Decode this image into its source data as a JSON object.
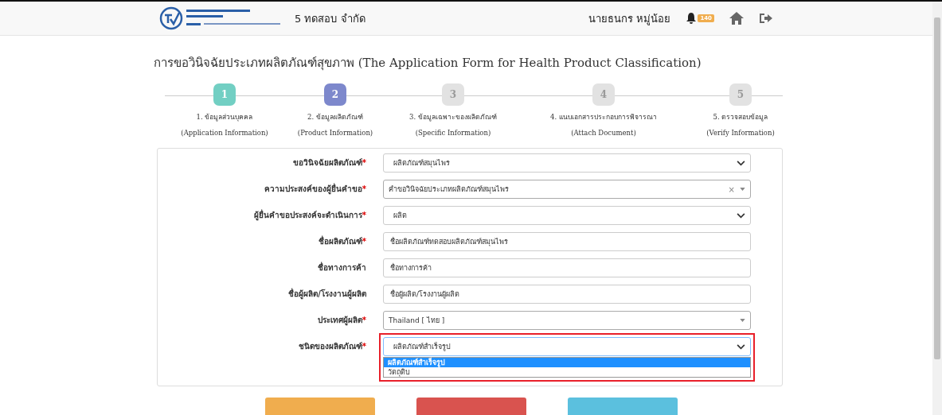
{
  "header": {
    "company": "5 ทดสอบ จำกัด",
    "user": "นายธนกร หมู่น้อย",
    "notification_count": "140"
  },
  "title": "การขอวินิจฉัยประเภทผลิตภัณฑ์สุขภาพ (The Application Form for Health Product Classification)",
  "steps": [
    {
      "number": "1",
      "label": "1. ข้อมูลส่วนบุคคล",
      "sublabel": "(Application Information)",
      "done": true,
      "current": false
    },
    {
      "number": "2",
      "label": "2. ข้อมูลผลิตภัณฑ์",
      "sublabel": "(Product Information)",
      "done": false,
      "current": true
    },
    {
      "number": "3",
      "label": "3. ข้อมูลเฉพาะของผลิตภัณฑ์",
      "sublabel": "(Specific Information)",
      "done": false,
      "current": false
    },
    {
      "number": "4",
      "label": "4. แนบเอกสารประกอบการพิจารณา",
      "sublabel": "(Attach Document)",
      "done": false,
      "current": false
    },
    {
      "number": "5",
      "label": "5. ตรวจสอบข้อมูล",
      "sublabel": "(Verify Information)",
      "done": false,
      "current": false
    }
  ],
  "fields": [
    {
      "label": "ขอวินิจฉัยผลิตภัณฑ์",
      "required_mark": "*",
      "kind": "select",
      "value": "ผลิตภัณฑ์สมุนไพร"
    },
    {
      "label": "ความประสงค์ของผู้ยื่นคำขอ",
      "required_mark": "*",
      "kind": "combo",
      "value": "คำขอวินิจฉัยประเภทผลิตภัณฑ์สมุนไพร",
      "clear": "×"
    },
    {
      "label": "ผู้ยื่นคำขอประสงค์จะดำเนินการ",
      "required_mark": "*",
      "kind": "select",
      "value": "ผลิต"
    },
    {
      "label": "ชื่อผลิตภัณฑ์",
      "required_mark": "*",
      "kind": "text",
      "value": "ชื่อผลิตภัณฑ์ทดสอบผลิตภัณฑ์สมุนไพร"
    },
    {
      "label": "ชื่อทางการค้า",
      "kind": "text",
      "placeholder": "ชื่อทางการค้า"
    },
    {
      "label": "ชื่อผู้ผลิต/โรงงานผู้ผลิต",
      "kind": "text",
      "placeholder": "ชื่อผู้ผลิต/โรงงานผู้ผลิต"
    },
    {
      "label": "ประเทศผู้ผลิต",
      "required_mark": "*",
      "kind": "combo",
      "value": "Thailand [ ไทย ]"
    },
    {
      "label": "ชนิดของผลิตภัณฑ์",
      "required_mark": "*",
      "kind": "select",
      "value": "ผลิตภัณฑ์สำเร็จรูป",
      "expanded": true,
      "options": [
        {
          "label": "ผลิตภัณฑ์สำเร็จรูป",
          "selected": true
        },
        {
          "label": "วัตถุดิบ",
          "selected": false
        }
      ]
    }
  ],
  "buttons": [
    {
      "color": "#f0ad4e"
    },
    {
      "color": "#d9534f"
    },
    {
      "color": "#5bc0de"
    }
  ]
}
